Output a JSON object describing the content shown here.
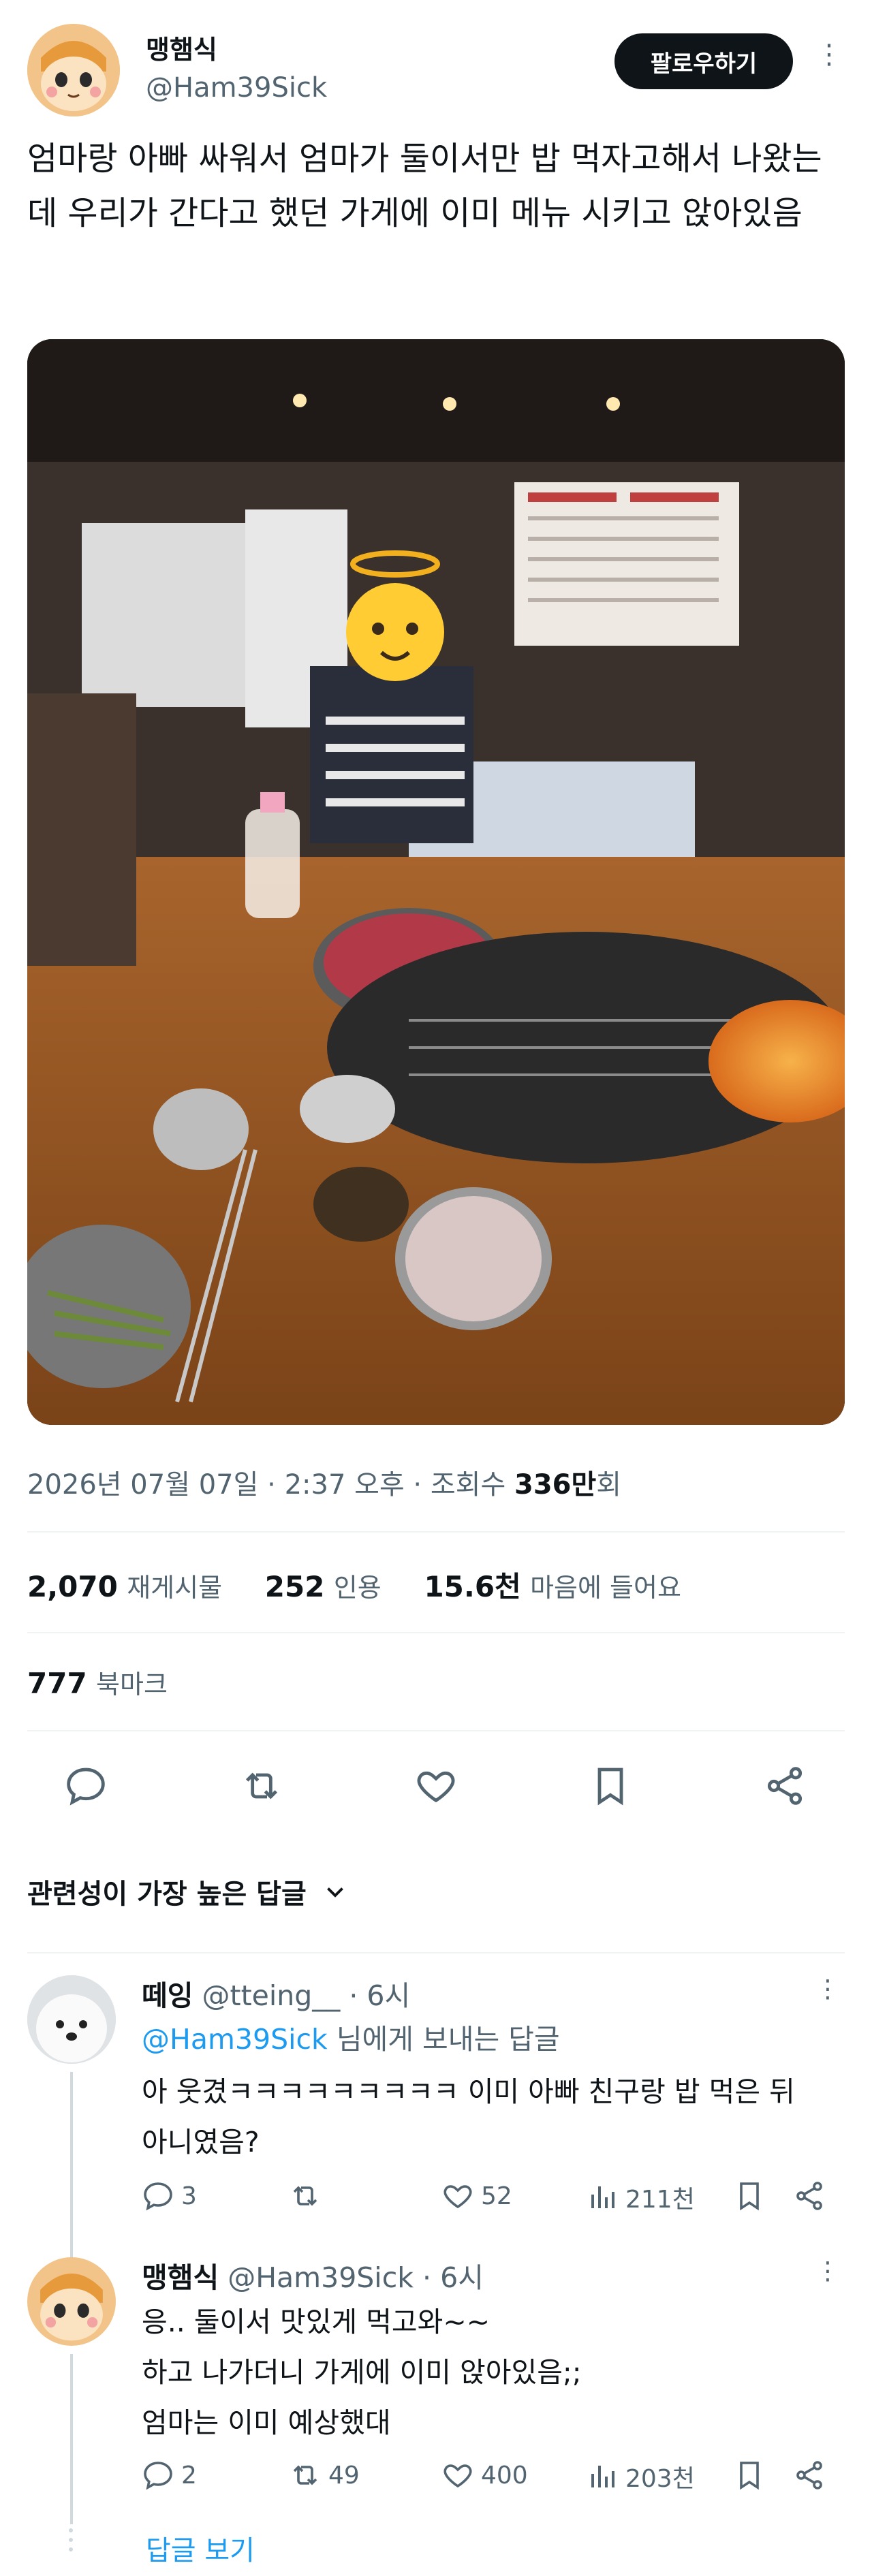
{
  "author": {
    "name": "맹햄식",
    "handle": "@Ham39Sick"
  },
  "follow_label": "팔로우하기",
  "tweet_text": "엄마랑 아빠 싸워서 엄마가 둘이서만 밥 먹자고해서 나왔는데 우리가 간다고 했던 가게에  이미 메뉴 시키고 앉아있음",
  "meta": {
    "timestamp": "2026년 07월 07일 · 2:37 오후 · 조회수",
    "views_num": "336만",
    "views_unit": "회"
  },
  "stats": {
    "retweets_num": "2,070",
    "retweets_label": "재게시물",
    "quotes_num": "252",
    "quotes_label": "인용",
    "likes_num": "15.6천",
    "likes_label": "마음에 들어요",
    "bookmarks_num": "777",
    "bookmarks_label": "북마크"
  },
  "sort_label": "관련성이 가장 높은 답글",
  "replies": [
    {
      "name": "떼잉",
      "handle": "@tteing__",
      "time": "· 6시",
      "reply_to_handle": "@Ham39Sick",
      "reply_to_suffix": " 님에게 보내는 답글",
      "lines": [
        "아 웃겼ㅋㅋㅋㅋㅋㅋㅋㅋㅋ 이미 아빠 친구랑 밥 먹은 뒤",
        "아니였음?"
      ],
      "comments": "3",
      "retweets": "",
      "likes": "52",
      "views": "211천"
    },
    {
      "name": "맹햄식",
      "handle": "@Ham39Sick",
      "time": "· 6시",
      "lines": [
        "응.. 둘이서 맛있게 먹고와~~",
        "하고 나가더니 가게에 이미 앉아있음;;",
        "엄마는 이미 예상했대"
      ],
      "comments": "2",
      "retweets": "49",
      "likes": "400",
      "views": "203천"
    }
  ],
  "show_replies_label": "답글 보기",
  "colors": {
    "accent": "#1d9bf0",
    "text": "#0f1419",
    "muted": "#536471",
    "divider": "#eff3f4"
  }
}
